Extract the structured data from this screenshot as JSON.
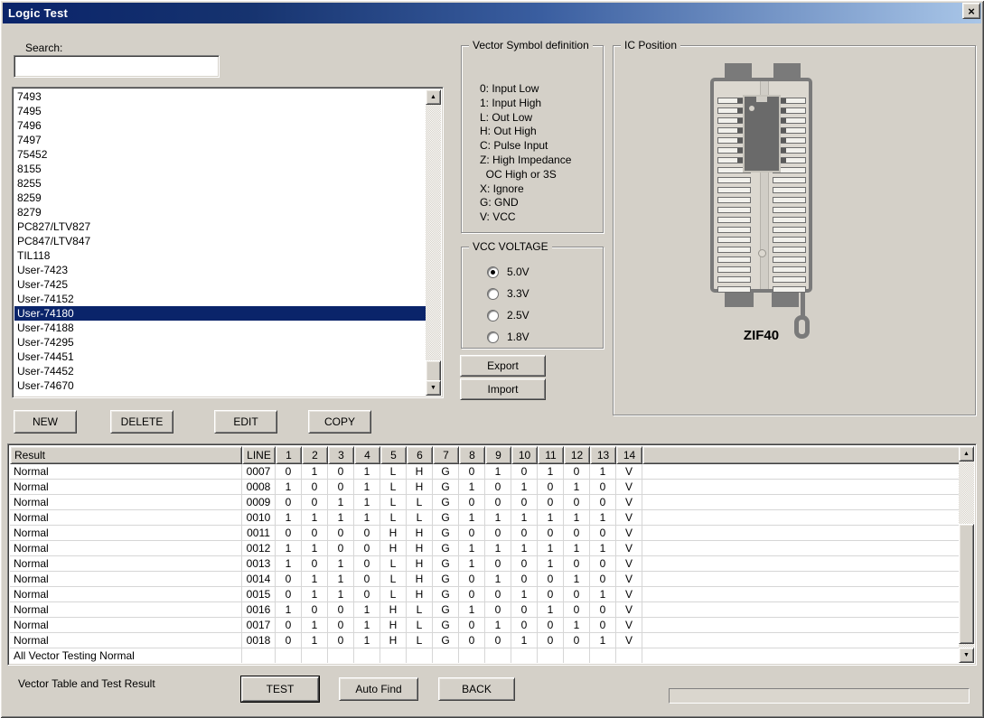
{
  "window": {
    "title": "Logic Test"
  },
  "icons": {
    "close": "×",
    "arrow_up": "▲",
    "arrow_down": "▼"
  },
  "colors": {
    "face": "#d4d0c8",
    "titlebar_left": "#0a246a",
    "titlebar_right": "#a9c6e8",
    "selection": "#0a246a"
  },
  "search": {
    "label": "Search:",
    "value": ""
  },
  "device_list": {
    "items": [
      "7493",
      "7495",
      "7496",
      "7497",
      "75452",
      "8155",
      "8255",
      "8259",
      "8279",
      "PC827/LTV827",
      "PC847/LTV847",
      "TIL118",
      "User-7423",
      "User-7425",
      "User-74152",
      "User-74180",
      "User-74188",
      "User-74295",
      "User-74451",
      "User-74452",
      "User-74670"
    ],
    "selected_index": 15,
    "selected_value": "User-74180"
  },
  "list_buttons": {
    "new": "NEW",
    "delete": "DELETE",
    "edit": "EDIT",
    "copy": "COPY"
  },
  "vector_symbols": {
    "title": "Vector Symbol definition",
    "lines": [
      "0: Input Low",
      "1: Input High",
      "L: Out Low",
      "H: Out High",
      "C: Pulse Input",
      "Z: High Impedance",
      "  OC High or 3S",
      "X: Ignore",
      "G: GND",
      "V: VCC"
    ]
  },
  "vcc": {
    "title": "VCC VOLTAGE",
    "options": [
      {
        "label": "5.0V",
        "selected": true
      },
      {
        "label": "3.3V",
        "selected": false
      },
      {
        "label": "2.5V",
        "selected": false
      },
      {
        "label": "1.8V",
        "selected": false
      }
    ]
  },
  "io_buttons": {
    "export": "Export",
    "import": "Import"
  },
  "ic_position": {
    "title": "IC Position",
    "socket_label": "ZIF40",
    "pins_per_side": 20,
    "chip_rows": 7
  },
  "result_table": {
    "headers": [
      "Result",
      "LINE",
      "1",
      "2",
      "3",
      "4",
      "5",
      "6",
      "7",
      "8",
      "9",
      "10",
      "11",
      "12",
      "13",
      "14"
    ],
    "rows": [
      [
        "Normal",
        "0007",
        "0",
        "1",
        "0",
        "1",
        "L",
        "H",
        "G",
        "0",
        "1",
        "0",
        "1",
        "0",
        "1",
        "V"
      ],
      [
        "Normal",
        "0008",
        "1",
        "0",
        "0",
        "1",
        "L",
        "H",
        "G",
        "1",
        "0",
        "1",
        "0",
        "1",
        "0",
        "V"
      ],
      [
        "Normal",
        "0009",
        "0",
        "0",
        "1",
        "1",
        "L",
        "L",
        "G",
        "0",
        "0",
        "0",
        "0",
        "0",
        "0",
        "V"
      ],
      [
        "Normal",
        "0010",
        "1",
        "1",
        "1",
        "1",
        "L",
        "L",
        "G",
        "1",
        "1",
        "1",
        "1",
        "1",
        "1",
        "V"
      ],
      [
        "Normal",
        "0011",
        "0",
        "0",
        "0",
        "0",
        "H",
        "H",
        "G",
        "0",
        "0",
        "0",
        "0",
        "0",
        "0",
        "V"
      ],
      [
        "Normal",
        "0012",
        "1",
        "1",
        "0",
        "0",
        "H",
        "H",
        "G",
        "1",
        "1",
        "1",
        "1",
        "1",
        "1",
        "V"
      ],
      [
        "Normal",
        "0013",
        "1",
        "0",
        "1",
        "0",
        "L",
        "H",
        "G",
        "1",
        "0",
        "0",
        "1",
        "0",
        "0",
        "V"
      ],
      [
        "Normal",
        "0014",
        "0",
        "1",
        "1",
        "0",
        "L",
        "H",
        "G",
        "0",
        "1",
        "0",
        "0",
        "1",
        "0",
        "V"
      ],
      [
        "Normal",
        "0015",
        "0",
        "1",
        "1",
        "0",
        "L",
        "H",
        "G",
        "0",
        "0",
        "1",
        "0",
        "0",
        "1",
        "V"
      ],
      [
        "Normal",
        "0016",
        "1",
        "0",
        "0",
        "1",
        "H",
        "L",
        "G",
        "1",
        "0",
        "0",
        "1",
        "0",
        "0",
        "V"
      ],
      [
        "Normal",
        "0017",
        "0",
        "1",
        "0",
        "1",
        "H",
        "L",
        "G",
        "0",
        "1",
        "0",
        "0",
        "1",
        "0",
        "V"
      ],
      [
        "Normal",
        "0018",
        "0",
        "1",
        "0",
        "1",
        "H",
        "L",
        "G",
        "0",
        "0",
        "1",
        "0",
        "0",
        "1",
        "V"
      ]
    ],
    "status_row": "All Vector Testing Normal"
  },
  "footer": {
    "label": "Vector Table and Test Result",
    "test": "TEST",
    "auto_find": "Auto Find",
    "back": "BACK"
  }
}
